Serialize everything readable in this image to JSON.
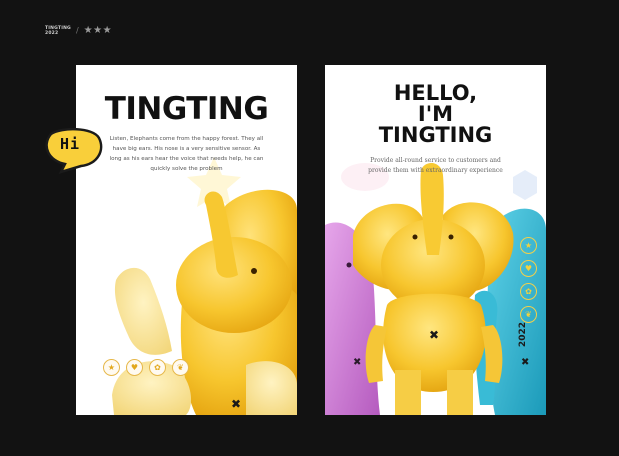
{
  "brand": {
    "line1": "TINGTING",
    "line2": "2022",
    "separator": "/",
    "stars": "★★★"
  },
  "left_card": {
    "title": "TINGTING",
    "description": "Listen, Elephants come from the happy forest. They all have big ears. His nose is a very sensitive sensor. As long as his ears hear the voice that needs help, he can quickly solve the problem",
    "bubble_text": "Hi",
    "icons": [
      "star-icon",
      "heart-icon",
      "flower-icon",
      "butterfly-icon"
    ],
    "icon_glyphs": [
      "★",
      "♥",
      "✿",
      "❦"
    ]
  },
  "right_card": {
    "title_lines": [
      "HELLO,",
      "I'M",
      "TINGTING"
    ],
    "description": "Provide all-round service to customers and provide them with extraordinary experience",
    "icons": [
      "star-icon",
      "heart-icon",
      "flower-icon",
      "butterfly-icon"
    ],
    "icon_glyphs": [
      "★",
      "♥",
      "✿",
      "❦"
    ],
    "year": "2022"
  },
  "colors": {
    "background": "#121212",
    "card": "#ffffff",
    "elephant_yellow": "#f6c72c",
    "elephant_pink": "#d184d6",
    "elephant_blue": "#2ab7d6",
    "text_dark": "#111111"
  }
}
